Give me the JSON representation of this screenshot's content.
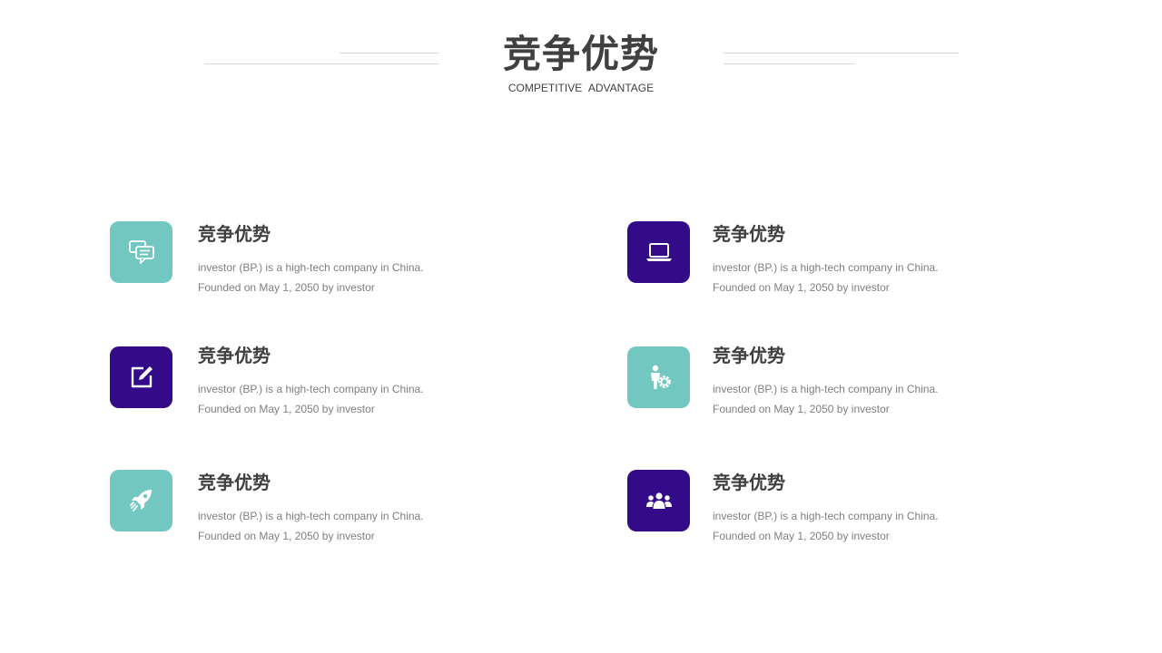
{
  "header": {
    "title": "竞争优势",
    "subtitle": "COMPETITIVE  ADVANTAGE"
  },
  "colors": {
    "teal": "#72c7c1",
    "purple": "#330a87",
    "text_dark": "#404040",
    "text_gray": "#7f7f7f",
    "rule": "#d9d9d9"
  },
  "items": [
    {
      "icon": "chat-bubbles-icon",
      "icon_color": "teal",
      "title": "竞争优势",
      "line1": "investor (BP.) is a high-tech company in China.",
      "line2": "Founded on May 1, 2050 by investor"
    },
    {
      "icon": "laptop-icon",
      "icon_color": "purple",
      "title": "竞争优势",
      "line1": "investor (BP.) is a high-tech company in China.",
      "line2": "Founded on May 1, 2050 by investor"
    },
    {
      "icon": "edit-icon",
      "icon_color": "purple",
      "title": "竞争优势",
      "line1": "investor (BP.) is a high-tech company in China.",
      "line2": "Founded on May 1, 2050 by investor"
    },
    {
      "icon": "person-gear-icon",
      "icon_color": "teal",
      "title": "竞争优势",
      "line1": "investor (BP.) is a high-tech company in China.",
      "line2": "Founded on May 1, 2050 by investor"
    },
    {
      "icon": "rocket-icon",
      "icon_color": "teal",
      "title": "竞争优势",
      "line1": "investor (BP.) is a high-tech company in China.",
      "line2": "Founded on May 1, 2050 by investor"
    },
    {
      "icon": "team-icon",
      "icon_color": "purple",
      "title": "竞争优势",
      "line1": "investor (BP.) is a high-tech company in China.",
      "line2": "Founded on May 1, 2050 by investor"
    }
  ]
}
